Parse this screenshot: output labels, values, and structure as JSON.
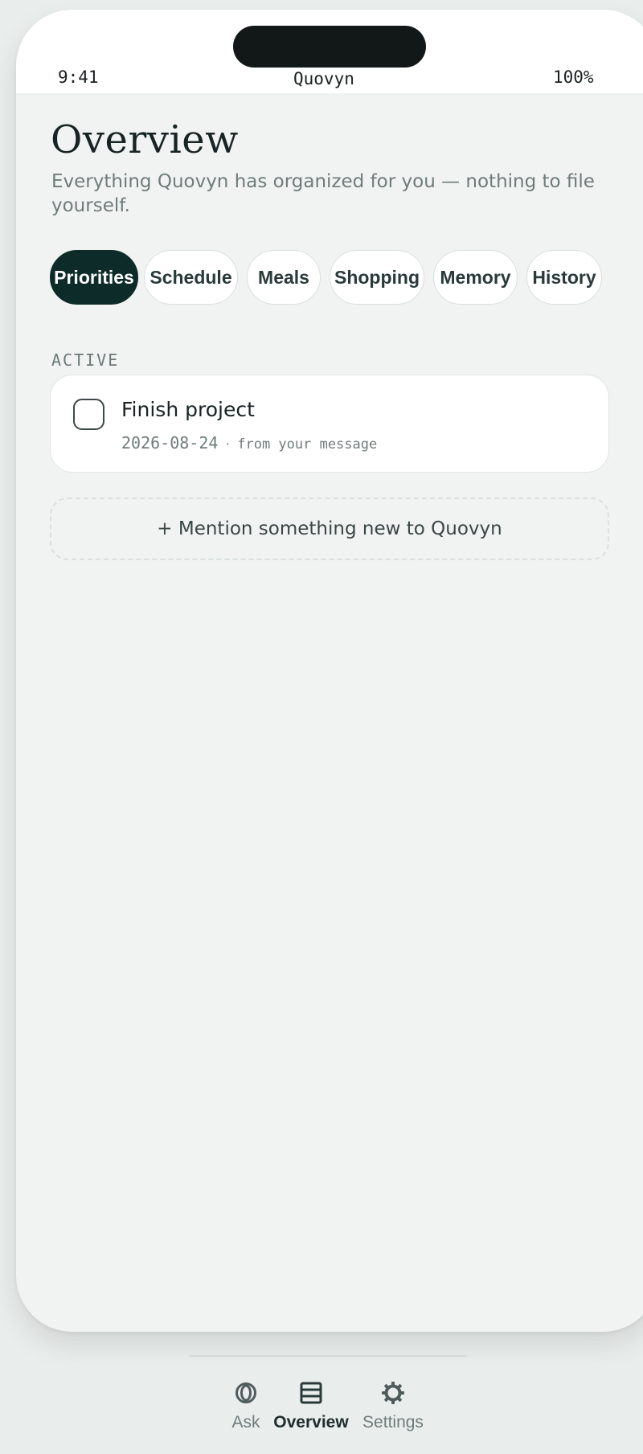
{
  "status_bar": {
    "time": "9:41",
    "title": "Quovyn",
    "battery": "100%"
  },
  "header": {
    "title": "Overview",
    "subtitle": "Everything Quovyn has organized for you — nothing to file yourself."
  },
  "tabs": [
    {
      "label": "Priorities",
      "active": true
    },
    {
      "label": "Schedule",
      "active": false
    },
    {
      "label": "Meals",
      "active": false
    },
    {
      "label": "Shopping",
      "active": false
    },
    {
      "label": "Memory",
      "active": false
    },
    {
      "label": "History",
      "active": false
    }
  ],
  "section": {
    "label": "ACTIVE"
  },
  "tasks": [
    {
      "title": "Finish project",
      "date": "2026-08-24",
      "separator": "·",
      "source": "from your message",
      "checked": false
    }
  ],
  "mention_button": {
    "label": "+ Mention something new to Quovyn"
  },
  "bottom_nav": [
    {
      "label": "Ask",
      "icon": "ask-rings-icon",
      "active": false
    },
    {
      "label": "Overview",
      "icon": "list-icon",
      "active": true
    },
    {
      "label": "Settings",
      "icon": "gear-icon",
      "active": false
    }
  ],
  "colors": {
    "accent": "#0d2b28",
    "background": "#f1f3f2",
    "card": "#ffffff",
    "muted_text": "#6f7c7b"
  }
}
